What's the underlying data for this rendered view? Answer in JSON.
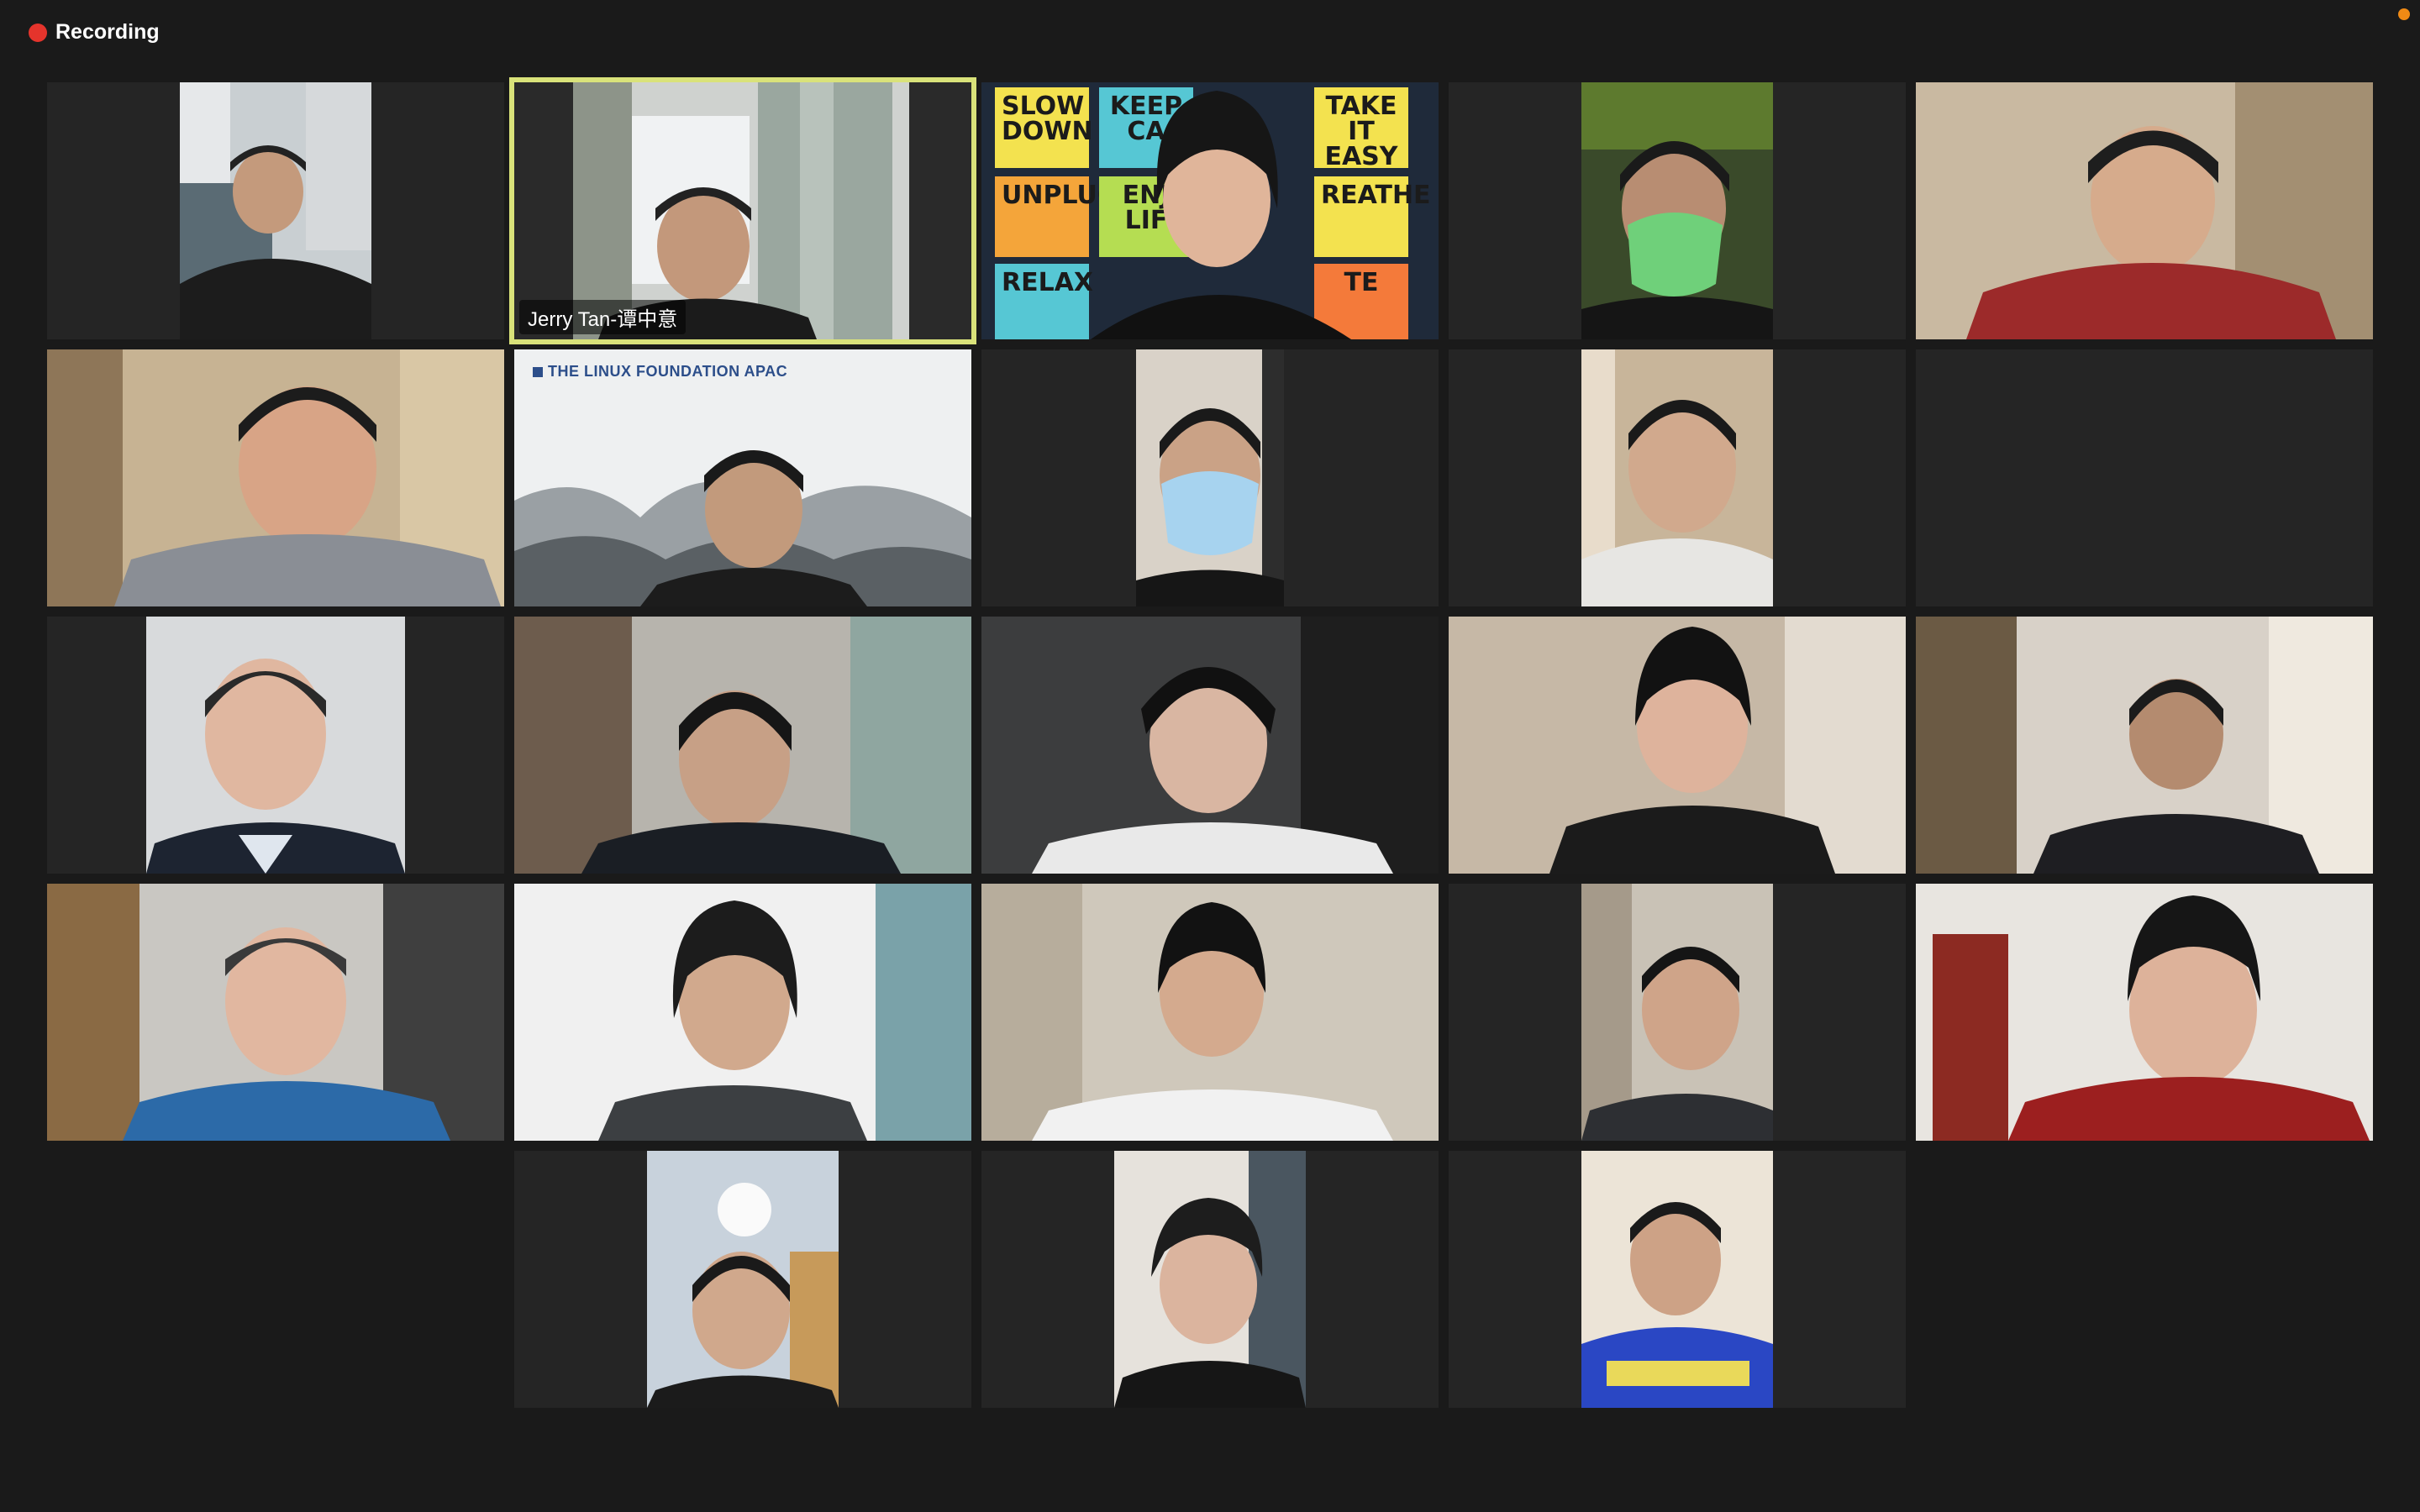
{
  "recording": {
    "label": "Recording",
    "dot_color": "#e5342c"
  },
  "accent": {
    "active_speaker_border": "#d9e27a",
    "notification_dot": "#f08a14"
  },
  "tiles": [
    {
      "name": ""
    },
    {
      "name": "Jerry Tan-谭中意",
      "active": true
    },
    {
      "name": "",
      "sticky_notes": [
        "SLOW DOWN",
        "KEEP CA",
        "TAKE IT EASY",
        "UNPLUG",
        "ENJ LIF",
        "REATHE",
        "RELAX",
        "TE"
      ]
    },
    {
      "name": ""
    },
    {
      "name": ""
    },
    {
      "name": ""
    },
    {
      "name": "",
      "background_logo": "THE LINUX FOUNDATION APAC"
    },
    {
      "name": ""
    },
    {
      "name": ""
    },
    {
      "name": ""
    },
    {
      "name": ""
    },
    {
      "name": ""
    },
    {
      "name": ""
    },
    {
      "name": ""
    },
    {
      "name": ""
    },
    {
      "name": ""
    },
    {
      "name": ""
    },
    {
      "name": ""
    },
    {
      "name": ""
    },
    {
      "name": ""
    },
    {
      "name": ""
    },
    {
      "name": ""
    }
  ]
}
